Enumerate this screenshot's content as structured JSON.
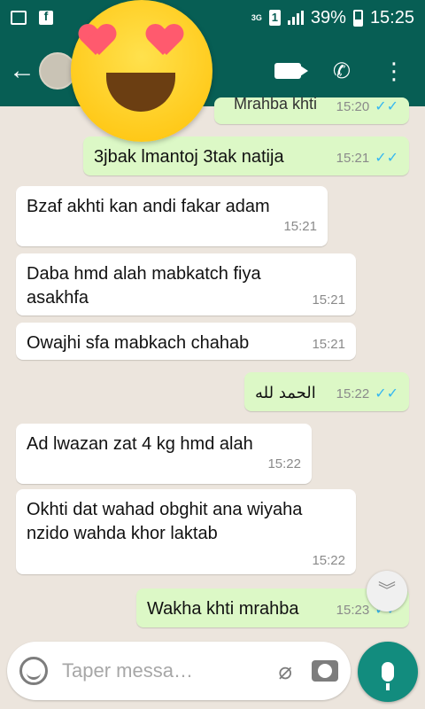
{
  "status_bar": {
    "network": "3G",
    "sim": "1",
    "battery": "39%",
    "time": "15:25"
  },
  "app_bar": {
    "contact_name": "…",
    "icons": [
      "back-arrow-icon",
      "video-call-icon",
      "phone-icon",
      "more-icon"
    ]
  },
  "messages": [
    {
      "dir": "out",
      "text": "Mrahba khti",
      "time": "15:20"
    },
    {
      "dir": "out",
      "text": "3jbak lmantoj 3tak natija",
      "time": "15:21"
    },
    {
      "dir": "in",
      "text": "Bzaf akhti kan andi fakar adam",
      "time": "15:21"
    },
    {
      "dir": "in",
      "text": "Daba  hmd alah mabkatch fiya asakhfa",
      "time": "15:21"
    },
    {
      "dir": "in",
      "text": "Owajhi sfa mabkach chahab",
      "time": "15:21"
    },
    {
      "dir": "out",
      "text": "الحمد لله",
      "time": "15:22"
    },
    {
      "dir": "in",
      "text": "Ad lwazan zat 4 kg hmd alah",
      "time": "15:22"
    },
    {
      "dir": "in",
      "text": "Okhti dat wahad obghit ana wiyaha nzido wahda khor laktab",
      "time": "15:22"
    },
    {
      "dir": "out",
      "text": "Wakha khti mrahba",
      "time": "15:23"
    }
  ],
  "input": {
    "placeholder": "Taper messa…"
  }
}
